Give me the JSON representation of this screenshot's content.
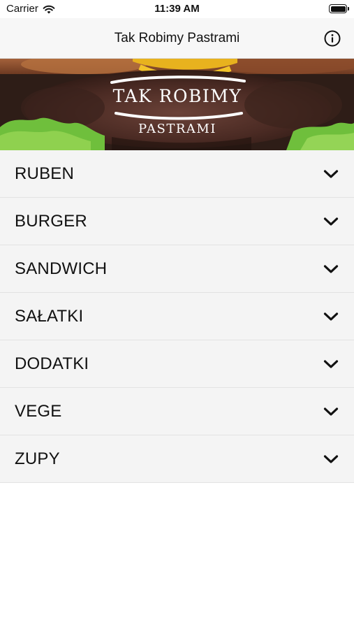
{
  "status_bar": {
    "carrier": "Carrier",
    "time": "11:39 AM"
  },
  "nav": {
    "title": "Tak Robimy Pastrami",
    "info_icon": "info-icon"
  },
  "hero": {
    "logo_line1": "TAK ROBIMY",
    "logo_line2": "PASTRAMI"
  },
  "menu": {
    "items": [
      {
        "label": "RUBEN"
      },
      {
        "label": "BURGER"
      },
      {
        "label": "SANDWICH"
      },
      {
        "label": "SAŁATKI"
      },
      {
        "label": "DODATKI"
      },
      {
        "label": "VEGE"
      },
      {
        "label": "ZUPY"
      }
    ],
    "expand_icon": "chevron-down-icon"
  },
  "colors": {
    "nav_background": "#f7f7f7",
    "row_background": "#f4f4f4",
    "text": "#111111"
  }
}
